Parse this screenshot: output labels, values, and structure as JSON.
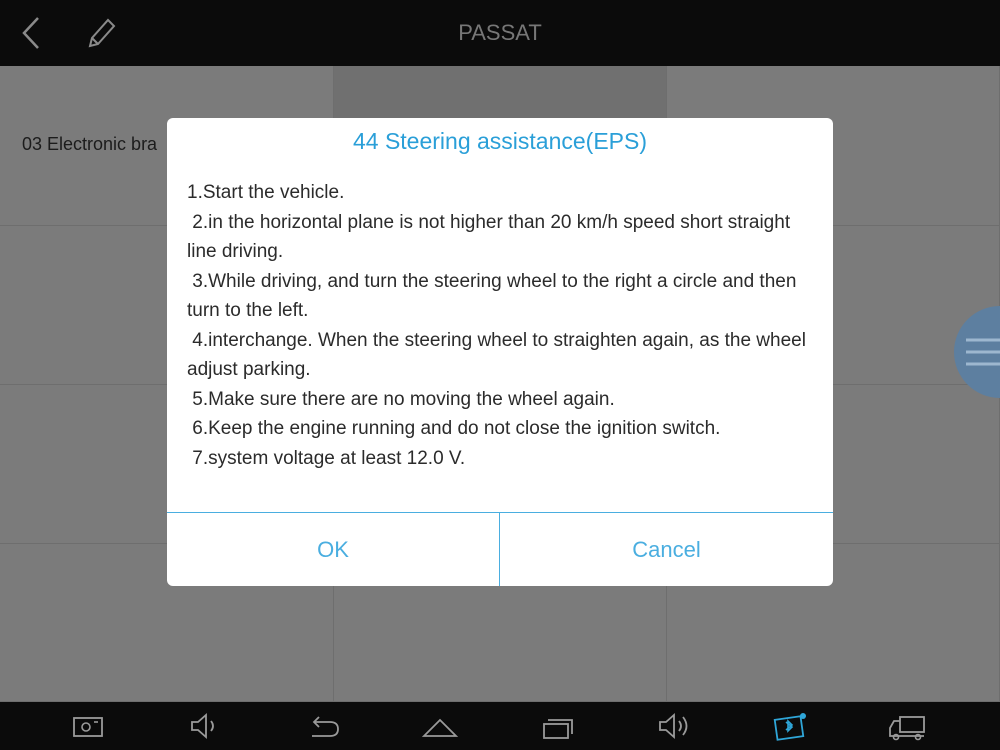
{
  "header": {
    "title": "PASSAT"
  },
  "grid": {
    "cells": [
      {
        "label": "03 Electronic bra"
      }
    ]
  },
  "dialog": {
    "title": "44 Steering assistance(EPS)",
    "lines": [
      "1.Start the vehicle.",
      " 2.in the horizontal plane is not higher than 20 km/h speed short straight line driving.",
      " 3.While driving, and turn the steering wheel to the right a circle and then turn to the left.",
      " 4.interchange. When the steering wheel to straighten again, as the wheel adjust parking.",
      " 5.Make sure there are no moving the wheel again.",
      " 6.Keep the engine running and do not close the ignition switch.",
      " 7.system voltage at least 12.0 V."
    ],
    "ok_label": "OK",
    "cancel_label": "Cancel"
  },
  "colors": {
    "accent": "#4aaee0",
    "title": "#2a9fd8"
  },
  "navbar": {
    "icons": [
      "screenshot-icon",
      "volume-down-icon",
      "back-icon",
      "home-icon",
      "recent-apps-icon",
      "volume-up-icon",
      "bluetooth-vci-icon",
      "truck-icon"
    ]
  }
}
